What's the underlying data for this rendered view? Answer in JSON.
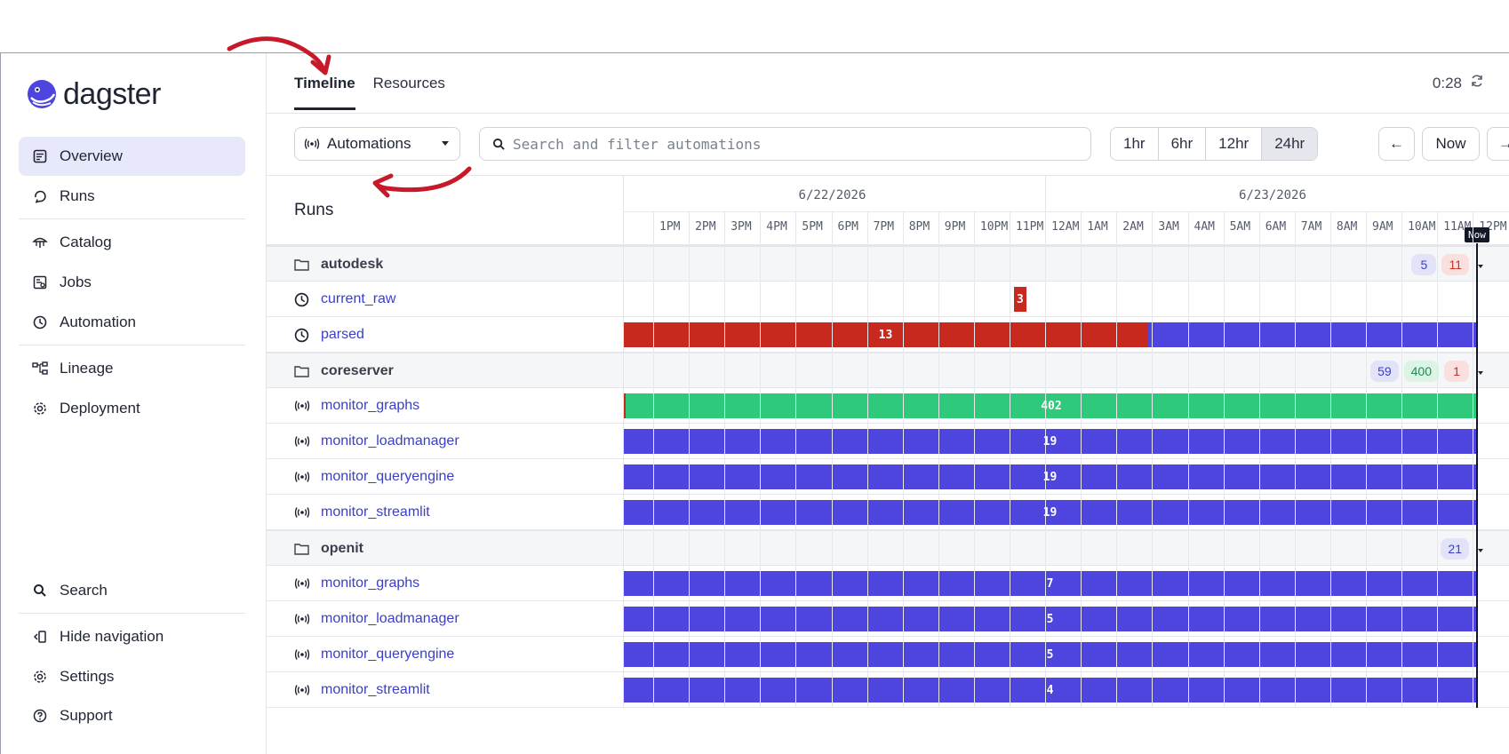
{
  "app": {
    "name": "dagster"
  },
  "sidebar": {
    "items": [
      {
        "label": "Overview",
        "icon": "overview-icon",
        "active": true
      },
      {
        "label": "Runs",
        "icon": "runs-icon"
      },
      {
        "label": "Catalog",
        "icon": "catalog-icon"
      },
      {
        "label": "Jobs",
        "icon": "jobs-icon"
      },
      {
        "label": "Automation",
        "icon": "clock-icon"
      },
      {
        "label": "Lineage",
        "icon": "lineage-icon"
      },
      {
        "label": "Deployment",
        "icon": "gear-icon"
      }
    ],
    "bottom": [
      {
        "label": "Search",
        "icon": "search-icon"
      },
      {
        "label": "Hide navigation",
        "icon": "hide-nav-icon"
      },
      {
        "label": "Settings",
        "icon": "gear-icon"
      },
      {
        "label": "Support",
        "icon": "help-icon"
      }
    ]
  },
  "tabs": [
    {
      "label": "Timeline",
      "active": true
    },
    {
      "label": "Resources",
      "active": false
    }
  ],
  "timer": "0:28",
  "toolbar": {
    "dropdown_label": "Automations",
    "search_placeholder": "Search and filter automations",
    "ranges": [
      {
        "label": "1hr",
        "active": false
      },
      {
        "label": "6hr",
        "active": false
      },
      {
        "label": "12hr",
        "active": false
      },
      {
        "label": "24hr",
        "active": true
      }
    ],
    "prev_label": "←",
    "now_label": "Now",
    "next_label": "→"
  },
  "timeline": {
    "title": "Runs",
    "dates": [
      "6/22/2026",
      "6/23/2026"
    ],
    "hours": [
      "1PM",
      "2PM",
      "3PM",
      "4PM",
      "5PM",
      "6PM",
      "7PM",
      "8PM",
      "9PM",
      "10PM",
      "11PM",
      "12AM",
      "1AM",
      "2AM",
      "3AM",
      "4AM",
      "5AM",
      "6AM",
      "7AM",
      "8AM",
      "9AM",
      "10AM",
      "11AM",
      "12PM"
    ],
    "now_label": "Now",
    "colors": {
      "failed": "#c8291f",
      "running": "#4e45df",
      "success": "#2ec97a"
    },
    "rows": [
      {
        "type": "group",
        "label": "autodesk",
        "badges": [
          {
            "value": "5",
            "kind": "blue"
          },
          {
            "value": "11",
            "kind": "red"
          }
        ]
      },
      {
        "type": "schedule",
        "label": "current_raw",
        "bars": [
          {
            "start": 0.4575,
            "end": 0.4725,
            "value": "3",
            "status": "failed"
          }
        ]
      },
      {
        "type": "schedule",
        "label": "parsed",
        "bars": [
          {
            "start": 0.0,
            "end": 0.615,
            "value": "13",
            "status": "failed"
          },
          {
            "start": 0.615,
            "end": 1.0,
            "value": "",
            "status": "running"
          }
        ]
      },
      {
        "type": "group",
        "label": "coreserver",
        "badges": [
          {
            "value": "59",
            "kind": "blue"
          },
          {
            "value": "400",
            "kind": "green"
          },
          {
            "value": "1",
            "kind": "red"
          }
        ]
      },
      {
        "type": "sensor",
        "label": "monitor_graphs",
        "bars": [
          {
            "start": 0.0,
            "end": 0.003,
            "value": "",
            "status": "failed"
          },
          {
            "start": 0.003,
            "end": 1.0,
            "value": "402",
            "status": "success"
          }
        ]
      },
      {
        "type": "sensor",
        "label": "monitor_loadmanager",
        "bars": [
          {
            "start": 0.0,
            "end": 1.0,
            "value": "19",
            "status": "running"
          }
        ]
      },
      {
        "type": "sensor",
        "label": "monitor_queryengine",
        "bars": [
          {
            "start": 0.0,
            "end": 1.0,
            "value": "19",
            "status": "running"
          }
        ]
      },
      {
        "type": "sensor",
        "label": "monitor_streamlit",
        "bars": [
          {
            "start": 0.0,
            "end": 1.0,
            "value": "19",
            "status": "running"
          }
        ]
      },
      {
        "type": "group",
        "label": "openit",
        "badges": [
          {
            "value": "21",
            "kind": "blue"
          }
        ]
      },
      {
        "type": "sensor",
        "label": "monitor_graphs",
        "bars": [
          {
            "start": 0.0,
            "end": 1.0,
            "value": "7",
            "status": "running"
          }
        ]
      },
      {
        "type": "sensor",
        "label": "monitor_loadmanager",
        "bars": [
          {
            "start": 0.0,
            "end": 1.0,
            "value": "5",
            "status": "running"
          }
        ]
      },
      {
        "type": "sensor",
        "label": "monitor_queryengine",
        "bars": [
          {
            "start": 0.0,
            "end": 1.0,
            "value": "5",
            "status": "running"
          }
        ]
      },
      {
        "type": "sensor",
        "label": "monitor_streamlit",
        "bars": [
          {
            "start": 0.0,
            "end": 1.0,
            "value": "4",
            "status": "running"
          }
        ]
      }
    ]
  }
}
